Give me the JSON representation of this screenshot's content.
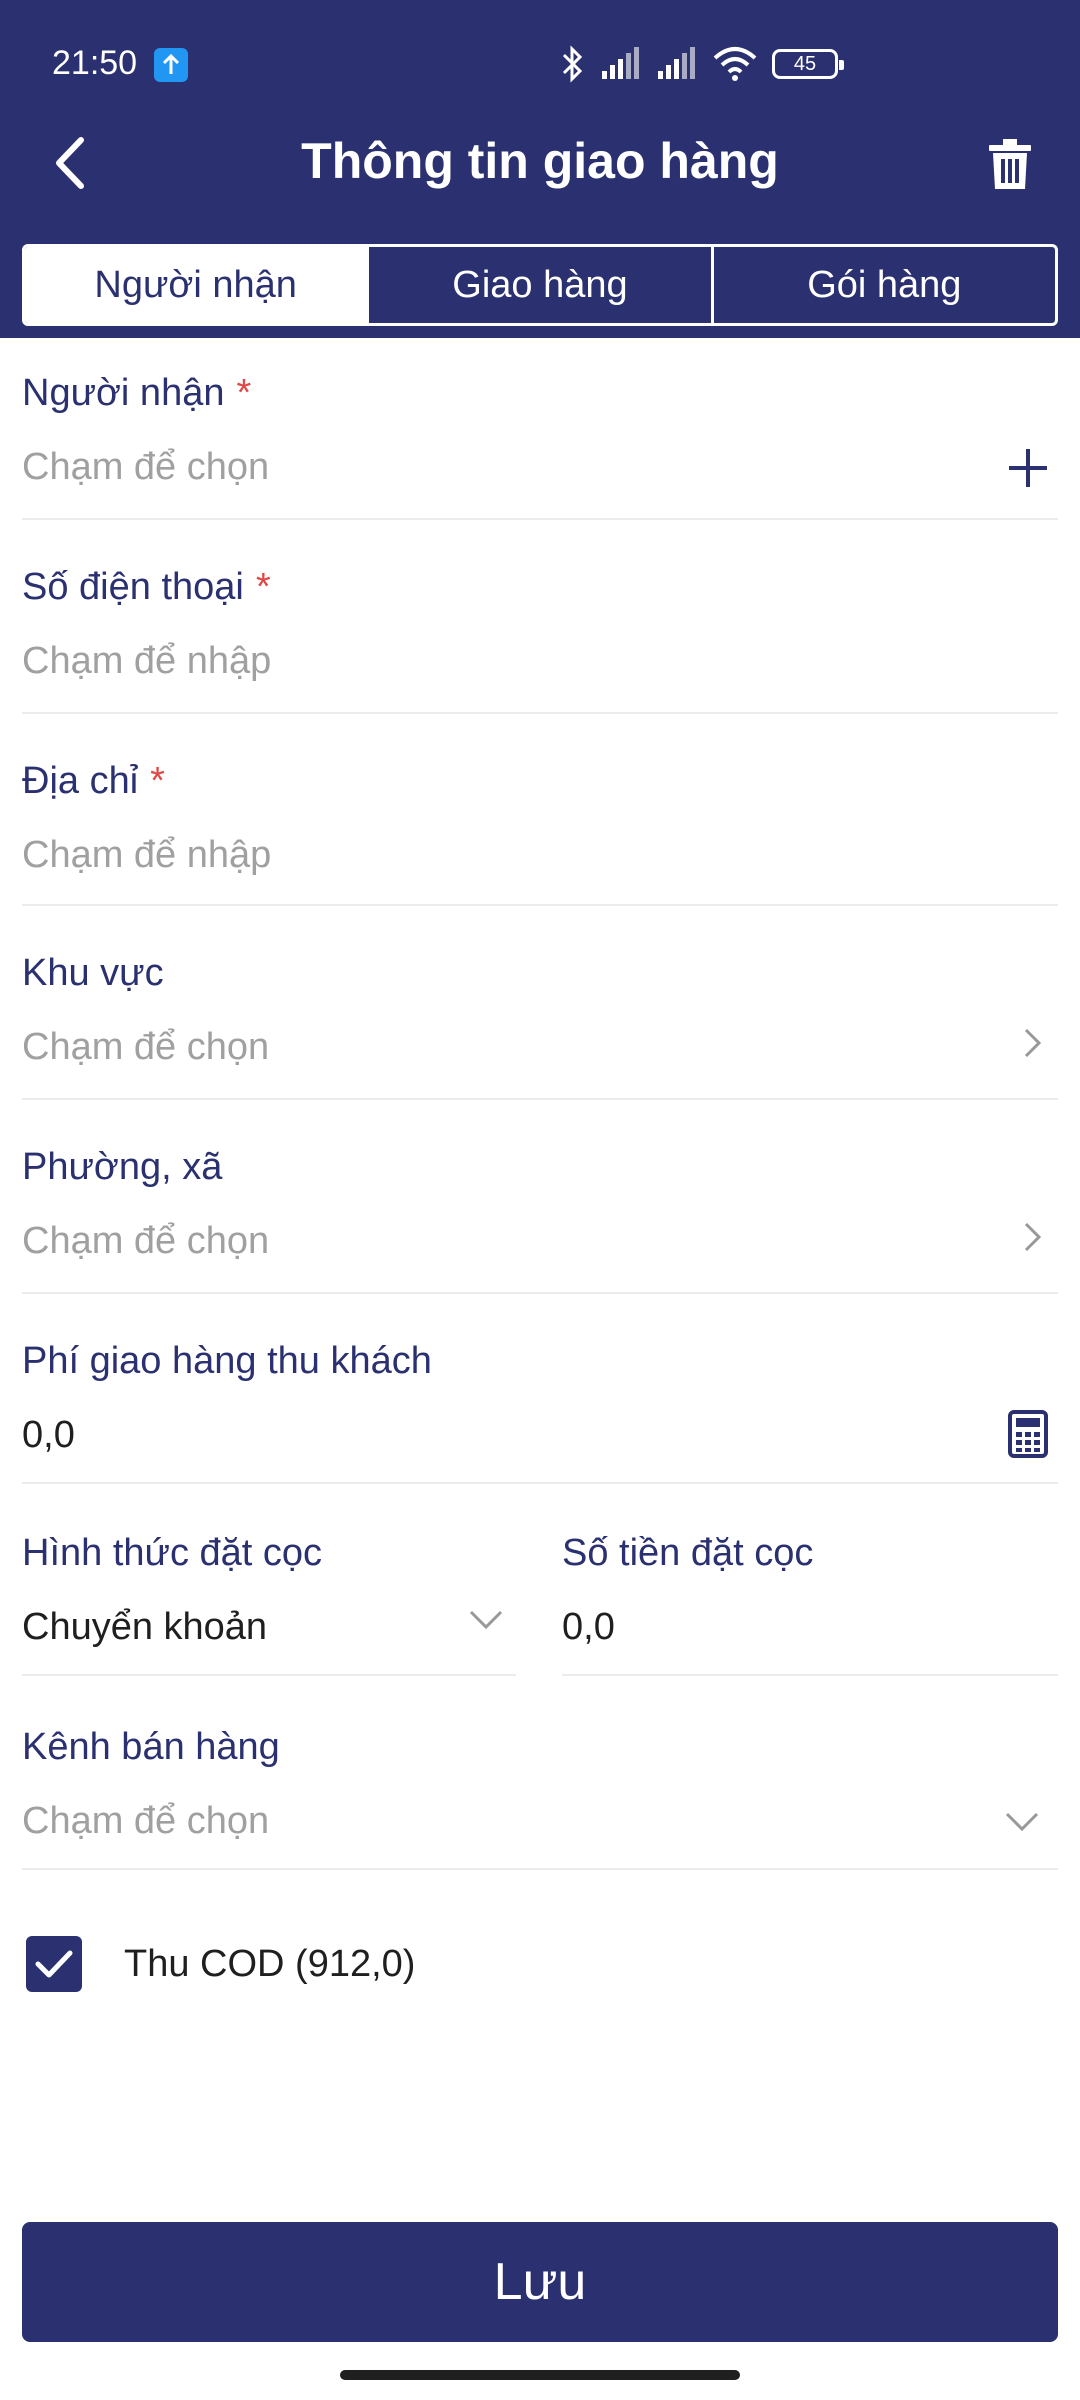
{
  "status_bar": {
    "time": "21:50",
    "battery": "45"
  },
  "toolbar": {
    "title": "Thông tin giao hàng"
  },
  "tabs": [
    {
      "label": "Người nhận",
      "active": true
    },
    {
      "label": "Giao hàng",
      "active": false
    },
    {
      "label": "Gói hàng",
      "active": false
    }
  ],
  "form": {
    "recipient": {
      "label": "Người nhận",
      "required": "*",
      "placeholder": "Chạm để chọn"
    },
    "phone": {
      "label": "Số điện thoại",
      "required": "*",
      "placeholder": "Chạm để nhập"
    },
    "address": {
      "label": "Địa chỉ",
      "required": "*",
      "placeholder": "Chạm để nhập"
    },
    "area": {
      "label": "Khu vực",
      "placeholder": "Chạm để chọn"
    },
    "ward": {
      "label": "Phường, xã",
      "placeholder": "Chạm để chọn"
    },
    "shipping_fee": {
      "label": "Phí giao hàng thu khách",
      "value": "0,0"
    },
    "deposit_method": {
      "label": "Hình thức đặt cọc",
      "value": "Chuyển khoản"
    },
    "deposit_amount": {
      "label": "Số tiền đặt cọc",
      "value": "0,0"
    },
    "sales_channel": {
      "label": "Kênh bán hàng",
      "placeholder": "Chạm để chọn"
    }
  },
  "cod": {
    "label": "Thu COD (912,0)",
    "checked": true
  },
  "save_label": "Lưu",
  "colors": {
    "primary": "#2b3170",
    "required": "#e04848",
    "placeholder": "#a0a0a0"
  }
}
